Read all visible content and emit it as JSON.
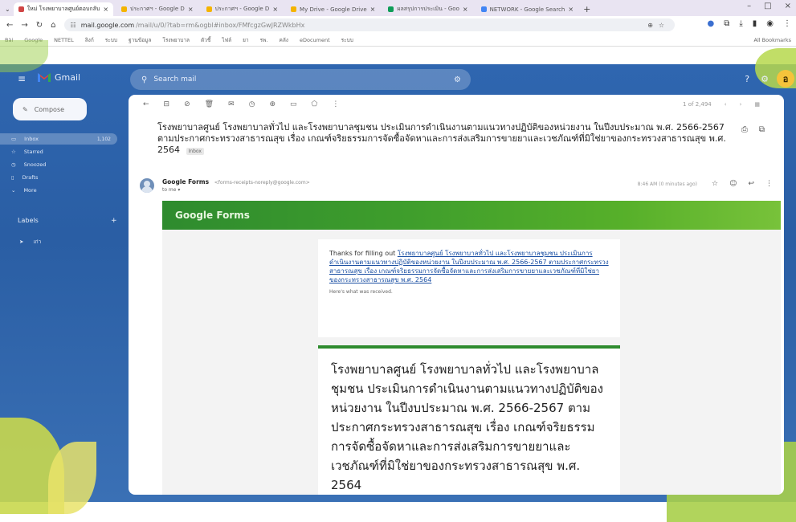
{
  "browser": {
    "tabs": [
      {
        "label": "ใหม่ โรงพยาบาลศูนย์ตอบกลับ",
        "color": "#d04545",
        "active": true
      },
      {
        "label": "ประกาศฯ - Google D",
        "color": "#f4b400",
        "active": false
      },
      {
        "label": "ประกาศฯ - Google D",
        "color": "#f4b400",
        "active": false
      },
      {
        "label": "My Drive - Google Drive",
        "color": "#f4b400",
        "active": false
      },
      {
        "label": "ผลสรุปการประเมิน - Goo",
        "color": "#0f9d58",
        "active": false
      },
      {
        "label": "NETWORK - Google Search",
        "color": "#4285f4",
        "active": false
      }
    ],
    "new_tab": "+",
    "window_controls": [
      "–",
      "□",
      "×"
    ],
    "url_host": "mail.google.com",
    "url_path": "/mail/u/0/?tab=rm&ogbl#inbox/FMfcgzGwJRZWkbHx",
    "bookmarks": [
      "Bài",
      "Google",
      "NETTEL",
      "ลิงก์",
      "ระบบ",
      "ฐานข้อมูล",
      "โรงพยาบาล",
      "ตัวชี้",
      "ไฟล์",
      "ยา",
      "รพ.",
      "คลัง",
      "eDocument",
      "ระบบ"
    ],
    "bookmarks_right": "All Bookmarks"
  },
  "gmail": {
    "app_name": "Gmail",
    "search_placeholder": "Search mail",
    "compose_label": "Compose",
    "sidebar": [
      {
        "label": "Inbox",
        "count": "1,102",
        "active": true
      },
      {
        "label": "Starred",
        "count": "",
        "active": false
      },
      {
        "label": "Snoozed",
        "count": "",
        "active": false
      },
      {
        "label": "Drafts",
        "count": "",
        "active": false
      },
      {
        "label": "More",
        "count": "",
        "active": false
      }
    ],
    "labels_heading": "Labels",
    "labels_add": "+",
    "label_items": [
      "เก่า"
    ],
    "avatar_letter": "อ",
    "pager": "1 of 2,494"
  },
  "email": {
    "subject": "โรงพยาบาลศูนย์ โรงพยาบาลทั่วไป และโรงพยาบาลชุมชน ประเมินการดำเนินงานตามแนวทางปฏิบัติของหน่วยงาน ในปีงบประมาณ พ.ศ. 2566-2567 ตามประกาศกระทรวงสาธารณสุข เรื่อง เกณฑ์จริยธรรมการจัดซื้อจัดหาและการส่งเสริมการขายยาและเวชภัณฑ์ที่มิใช่ยาของกระทรวงสาธารณสุข พ.ศ. 2564",
    "inbox_tag": "Inbox",
    "sender_name": "Google Forms",
    "sender_email": "<forms-receipts-noreply@google.com>",
    "to_me": "to me",
    "time": "8:46 AM (0 minutes ago)",
    "form_brand": "Google Forms",
    "thanks_prefix": "Thanks for filling out ",
    "thanks_link": "โรงพยาบาลศูนย์ โรงพยาบาลทั่วไป และโรงพยาบาลชุมชน ประเมินการดำเนินงานตามแนวทางปฏิบัติของหน่วยงาน ในปีงบประมาณ พ.ศ. 2566-2567 ตามประกาศกระทรวงสาธารณสุข เรื่อง เกณฑ์จริยธรรมการจัดซื้อจัดหาและการส่งเสริมการขายยาและเวชภัณฑ์ที่มิใช่ยาของกระทรวงสาธารณสุข พ.ศ. 2564",
    "received_note": "Here's what was received.",
    "form_title": "โรงพยาบาลศูนย์ โรงพยาบาลทั่วไป และโรงพยาบาลชุมชน ประเมินการดำเนินงานตามแนวทางปฏิบัติของหน่วยงาน ในปีงบประมาณ พ.ศ. 2566-2567 ตามประกาศกระทรวงสาธารณสุข เรื่อง เกณฑ์จริยธรรมการจัดซื้อจัดหาและการส่งเสริมการขายยาและเวชภัณฑ์ที่มิใช่ยาของกระทรวงสาธารณสุข พ.ศ. 2564"
  },
  "colors": {
    "gmail_bg": "#2f66b0",
    "form_green": "#2e8b2e",
    "link_blue": "#1a4fa3"
  }
}
